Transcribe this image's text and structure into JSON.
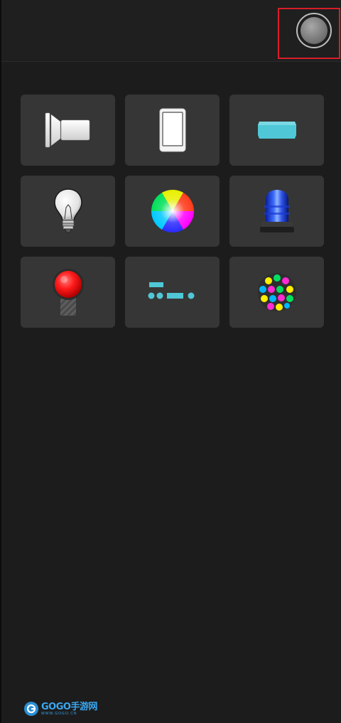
{
  "toolbar": {
    "toggle_icon": "power-toggle-icon"
  },
  "modes": [
    {
      "icon": "flashlight-icon"
    },
    {
      "icon": "screen-light-icon"
    },
    {
      "icon": "led-bar-icon"
    },
    {
      "icon": "light-bulb-icon"
    },
    {
      "icon": "color-wheel-icon"
    },
    {
      "icon": "police-siren-icon"
    },
    {
      "icon": "red-signal-light-icon"
    },
    {
      "icon": "morse-code-icon"
    },
    {
      "icon": "disco-ball-icon"
    }
  ],
  "watermark": {
    "main": "GOGO手游网",
    "sub": "WWW.GOGO.CN"
  },
  "colors": {
    "background": "#1c1c1c",
    "tile": "#363636",
    "accent_cyan": "#4fc7d6",
    "highlight_red": "#d81e28"
  }
}
